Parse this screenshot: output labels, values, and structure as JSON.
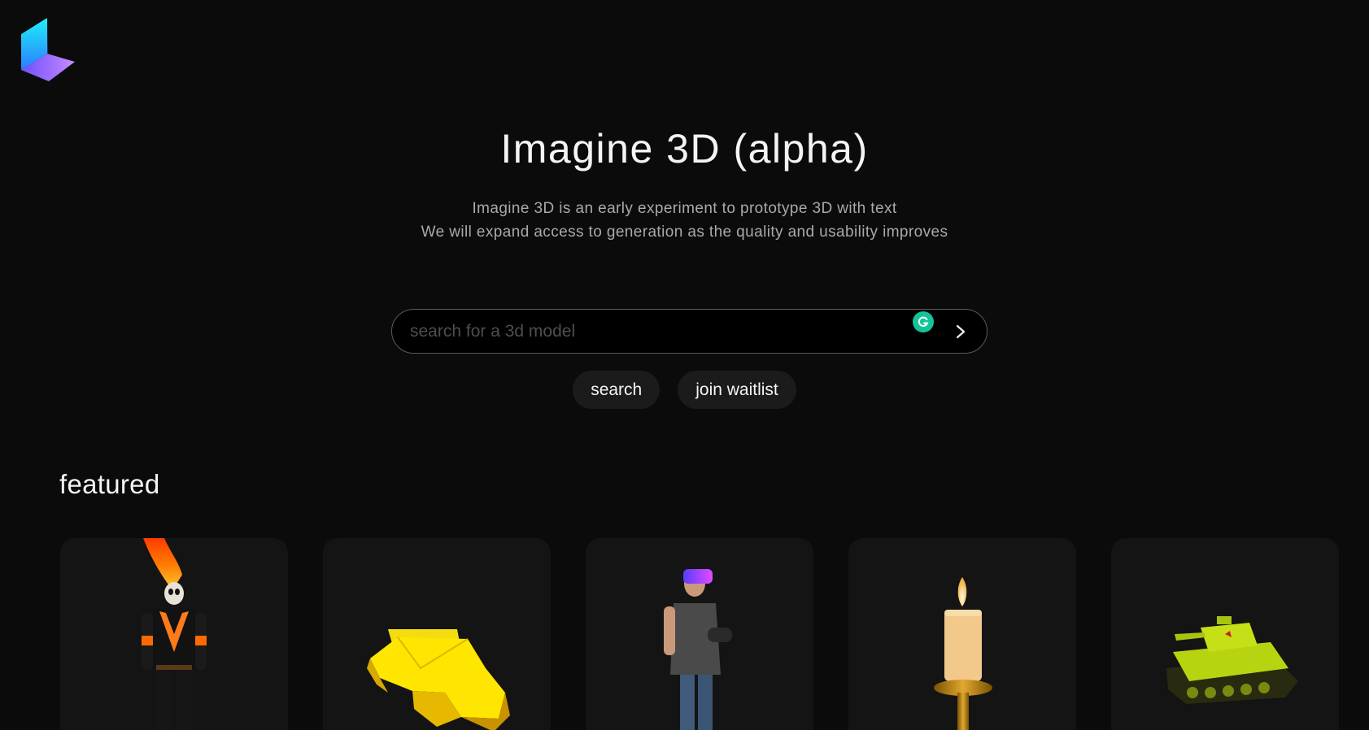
{
  "app": {
    "logo_name": "brand-logo",
    "accent_colors": [
      "#18e0f5",
      "#3b6bff",
      "#a05cff"
    ]
  },
  "hero": {
    "title": "Imagine 3D (alpha)",
    "subtitle_line1": "Imagine 3D is an early experiment to prototype 3D with text",
    "subtitle_line2": "We will expand access to generation as the quality and usability improves"
  },
  "search": {
    "placeholder": "search for a 3d model",
    "value": "",
    "submit_icon": "chevron-right-icon",
    "extension_icon": "grammarly-icon"
  },
  "actions": {
    "search_label": "search",
    "waitlist_label": "join waitlist"
  },
  "featured": {
    "title": "featured",
    "items": [
      {
        "subject": "flaming skull rider figure"
      },
      {
        "subject": "yellow origami vehicle"
      },
      {
        "subject": "man wearing vr headset"
      },
      {
        "subject": "lit candle on brass holder"
      },
      {
        "subject": "green army tank"
      }
    ]
  }
}
